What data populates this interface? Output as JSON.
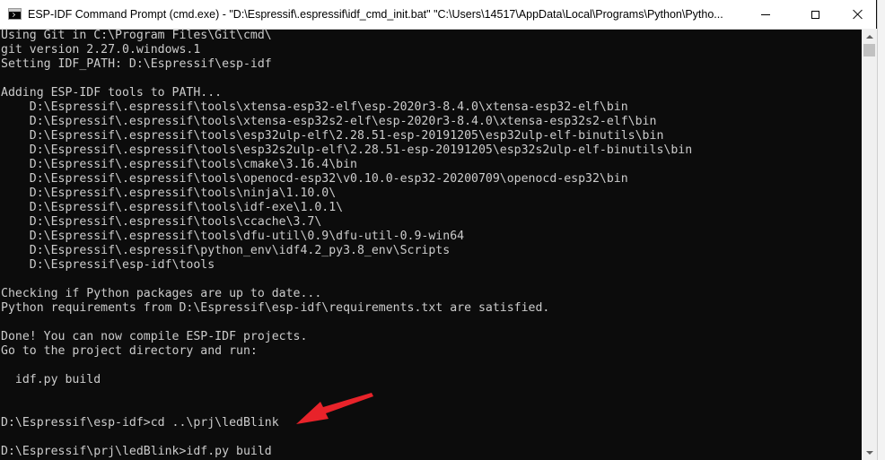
{
  "window": {
    "title": "ESP-IDF Command Prompt (cmd.exe) - \"D:\\Espressif\\.espressif\\idf_cmd_init.bat\"  \"C:\\Users\\14517\\AppData\\Local\\Programs\\Python\\Pytho...",
    "icon": "cmd-console-icon",
    "buttons": {
      "minimize": "minimize-icon",
      "maximize": "maximize-icon",
      "close": "close-icon"
    }
  },
  "terminal": {
    "lines": [
      "Using Git in C:\\Program Files\\Git\\cmd\\",
      "git version 2.27.0.windows.1",
      "Setting IDF_PATH: D:\\Espressif\\esp-idf",
      "",
      "Adding ESP-IDF tools to PATH...",
      "    D:\\Espressif\\.espressif\\tools\\xtensa-esp32-elf\\esp-2020r3-8.4.0\\xtensa-esp32-elf\\bin",
      "    D:\\Espressif\\.espressif\\tools\\xtensa-esp32s2-elf\\esp-2020r3-8.4.0\\xtensa-esp32s2-elf\\bin",
      "    D:\\Espressif\\.espressif\\tools\\esp32ulp-elf\\2.28.51-esp-20191205\\esp32ulp-elf-binutils\\bin",
      "    D:\\Espressif\\.espressif\\tools\\esp32s2ulp-elf\\2.28.51-esp-20191205\\esp32s2ulp-elf-binutils\\bin",
      "    D:\\Espressif\\.espressif\\tools\\cmake\\3.16.4\\bin",
      "    D:\\Espressif\\.espressif\\tools\\openocd-esp32\\v0.10.0-esp32-20200709\\openocd-esp32\\bin",
      "    D:\\Espressif\\.espressif\\tools\\ninja\\1.10.0\\",
      "    D:\\Espressif\\.espressif\\tools\\idf-exe\\1.0.1\\",
      "    D:\\Espressif\\.espressif\\tools\\ccache\\3.7\\",
      "    D:\\Espressif\\.espressif\\tools\\dfu-util\\0.9\\dfu-util-0.9-win64",
      "    D:\\Espressif\\.espressif\\python_env\\idf4.2_py3.8_env\\Scripts",
      "    D:\\Espressif\\esp-idf\\tools",
      "",
      "Checking if Python packages are up to date...",
      "Python requirements from D:\\Espressif\\esp-idf\\requirements.txt are satisfied.",
      "",
      "Done! You can now compile ESP-IDF projects.",
      "Go to the project directory and run:",
      "",
      "  idf.py build",
      "",
      "",
      "D:\\Espressif\\esp-idf>cd ..\\prj\\ledBlink",
      "",
      "D:\\Espressif\\prj\\ledBlink>idf.py build"
    ]
  },
  "annotation": {
    "arrow_color": "#e8232a",
    "icon": "red-arrow-icon"
  },
  "colors": {
    "terminal_bg": "#0c0c0c",
    "terminal_fg": "#cccccc",
    "titlebar_bg": "#ffffff"
  }
}
